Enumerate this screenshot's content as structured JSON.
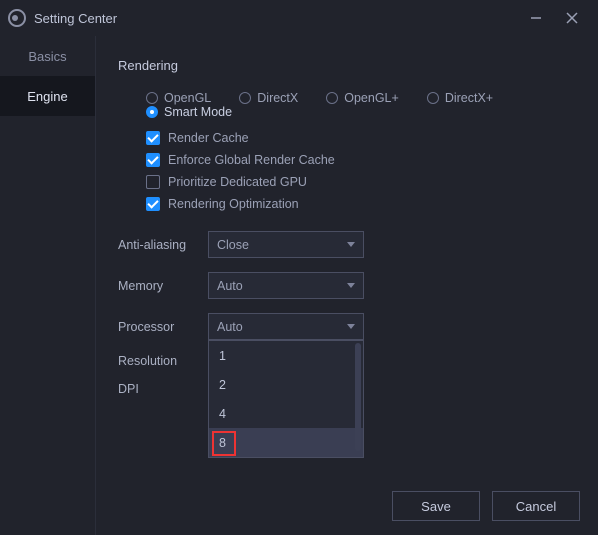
{
  "window": {
    "title": "Setting Center"
  },
  "sidebar": {
    "tabs": [
      {
        "label": "Basics",
        "active": false
      },
      {
        "label": "Engine",
        "active": true
      }
    ]
  },
  "section": {
    "title": "Rendering"
  },
  "renderer": {
    "options": [
      "OpenGL",
      "DirectX",
      "OpenGL+",
      "DirectX+",
      "Smart Mode"
    ],
    "selected": "Smart Mode"
  },
  "checks": [
    {
      "label": "Render Cache",
      "checked": true
    },
    {
      "label": "Enforce Global Render Cache",
      "checked": true
    },
    {
      "label": "Prioritize Dedicated GPU",
      "checked": false
    },
    {
      "label": "Rendering Optimization",
      "checked": true
    }
  ],
  "fields": {
    "anti_aliasing": {
      "label": "Anti-aliasing",
      "value": "Close"
    },
    "memory": {
      "label": "Memory",
      "value": "Auto"
    },
    "processor": {
      "label": "Processor",
      "value": "Auto",
      "open": true,
      "options": [
        "1",
        "2",
        "4",
        "8"
      ],
      "highlighted": "8"
    },
    "resolution": {
      "label": "Resolution"
    },
    "dpi": {
      "label": "DPI"
    }
  },
  "buttons": {
    "save": "Save",
    "cancel": "Cancel"
  }
}
